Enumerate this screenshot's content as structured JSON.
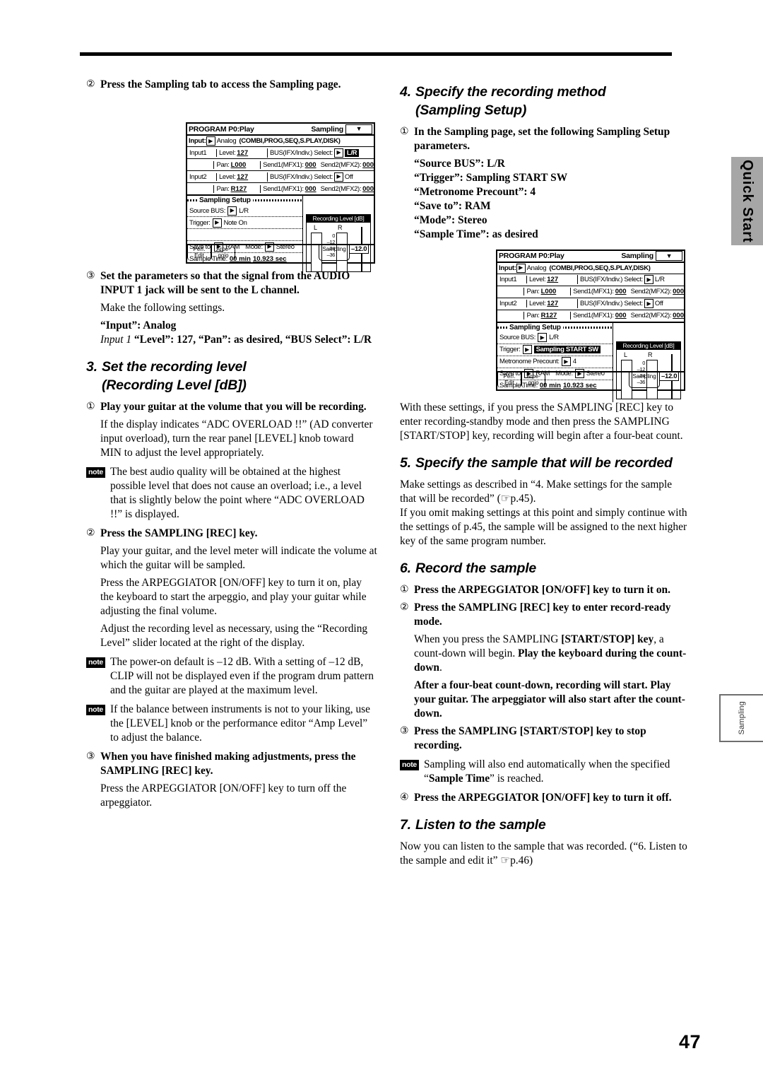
{
  "page": {
    "number": "47",
    "side_tabs": {
      "quick_start": "Quick Start",
      "sampling": "Sampling"
    }
  },
  "left_column": {
    "step2": {
      "circle": "②",
      "text": "Press the Sampling tab to access the Sampling page."
    },
    "step3": {
      "circle": "③",
      "text": "Set the parameters so that the signal from the AUDIO INPUT 1 jack will be sent to the L channel.",
      "body1": "Make the following settings.",
      "body2": "“Input”: Analog",
      "body3_italic": "Input 1",
      "body3_rest": " “Level”: 127, “Pan”: as desired, “BUS Select”: L/R"
    },
    "section3": {
      "number": "3.",
      "title_line1": "Set the recording level",
      "title_line2": "(Recording Level [dB])"
    },
    "s3_step1": {
      "circle": "①",
      "text": "Play your guitar at the volume that you will be recording.",
      "body": "If the display indicates “ADC OVERLOAD !!” (AD converter input overload), turn the rear panel [LEVEL] knob toward MIN to adjust the level appropriately."
    },
    "note1": {
      "badge": "note",
      "text": "The best audio quality will be obtained at the highest possible level that does not cause an overload; i.e., a level that is slightly below the point where “ADC OVERLOAD !!” is displayed."
    },
    "s3_step2": {
      "circle": "②",
      "text": "Press the SAMPLING [REC] key.",
      "body1": "Play your guitar, and the level meter will indicate the volume at which the guitar will be sampled.",
      "body2": "Press the ARPEGGIATOR [ON/OFF] key to turn it on, play the keyboard to start the arpeggio, and play your guitar while adjusting the final volume.",
      "body3": "Adjust the recording level as necessary, using the “Recording Level” slider located at the right of the display."
    },
    "note2": {
      "badge": "note",
      "text": "The power-on default is –12 dB. With a setting of –12 dB, CLIP will not be displayed even if the program drum pattern and the guitar are played at the maximum level."
    },
    "note3": {
      "badge": "note",
      "text": "If the balance between instruments is not to your liking, use the [LEVEL] knob or the performance editor “Amp Level” to adjust the balance."
    },
    "s3_step3": {
      "circle": "③",
      "text": "When you have finished making adjustments, press the SAMPLING [REC] key.",
      "body": "Press the ARPEGGIATOR [ON/OFF] key to turn off the arpeggiator."
    }
  },
  "right_column": {
    "section4": {
      "number": "4.",
      "title_line1": "Specify the recording method",
      "title_line2": "(Sampling Setup)"
    },
    "s4_step1": {
      "circle": "①",
      "text": "In the Sampling page, set the following Sampling Setup parameters.",
      "params": [
        "“Source BUS”: L/R",
        "“Trigger”: Sampling START SW",
        "“Metronome Precount”: 4",
        "“Save to”: RAM",
        "“Mode”: Stereo",
        "“Sample Time”: as desired"
      ]
    },
    "s4_body": "With these settings, if you press the SAMPLING [REC] key to enter recording-standby mode and then press the SAMPLING [START/STOP] key, recording will begin after a four-beat count.",
    "section5": {
      "number": "5.",
      "title": "Specify the sample that will be recorded",
      "body1": "Make settings as described in “4. Make settings for the sample that will be recorded” (☞p.45).",
      "body2": "If you omit making settings at this point and simply continue with the settings of p.45, the sample will be assigned to the next higher key of the same program number."
    },
    "section6": {
      "number": "6.",
      "title": "Record the sample"
    },
    "s6_step1": {
      "circle": "①",
      "text": "Press the ARPEGGIATOR [ON/OFF] key to turn it on."
    },
    "s6_step2": {
      "circle": "②",
      "text": "Press the SAMPLING [REC] key to enter record-ready mode.",
      "body1_a": "When you press the SAMPLING ",
      "body1_b": "[START/STOP] key",
      "body1_c": ", a count-down will begin. ",
      "body1_d": "Play the keyboard during the count-down",
      "body1_e": ".",
      "body2": "After a four-beat count-down, recording will start. Play your guitar. The arpeggiator will also start after the count-down."
    },
    "s6_step3": {
      "circle": "③",
      "text": "Press the SAMPLING [START/STOP] key to stop recording."
    },
    "note4": {
      "badge": "note",
      "text_a": "Sampling will also end automatically when the specified “",
      "text_b": "Sample Time",
      "text_c": "” is reached."
    },
    "s6_step4": {
      "circle": "④",
      "text": "Press the ARPEGGIATOR [ON/OFF] key to turn it off."
    },
    "section7": {
      "number": "7.",
      "title": "Listen to the sample",
      "body": "Now you can listen to the sample that was recorded. (“6. Listen to the sample and edit it” ☞p.46)"
    }
  },
  "lcd1": {
    "title_left": "PROGRAM P0:Play",
    "title_right": "Sampling",
    "dropdown_glyph": "▼",
    "input_label": "Input:",
    "input_value": "Analog",
    "input_modes": "(COMBI,PROG,SEQ,S.PLAY,DISK)",
    "rows": [
      {
        "name": "Input1",
        "param": "Level:",
        "value": "127",
        "bus": "BUS(IFX/Indiv.) Select:",
        "bus_value": "L/R",
        "bus_highlight": true
      },
      {
        "name": "",
        "param": "Pan:",
        "value": "L000",
        "send1": "Send1(MFX1):",
        "send1_value": "000",
        "send2": "Send2(MFX2):",
        "send2_value": "000"
      },
      {
        "name": "Input2",
        "param": "Level:",
        "value": "127",
        "bus": "BUS(IFX/Indiv.) Select:",
        "bus_value": "Off",
        "bus_highlight": false
      },
      {
        "name": "",
        "param": "Pan:",
        "value": "R127",
        "send1": "Send1(MFX1):",
        "send1_value": "000",
        "send2": "Send2(MFX2):",
        "send2_value": "000"
      }
    ],
    "setup_title": "Sampling Setup",
    "setup": {
      "source_bus_label": "Source BUS:",
      "source_bus_value": "L/R",
      "trigger_label": "Trigger:",
      "trigger_value": "Note On",
      "trigger_highlight": false,
      "precount_label": "",
      "precount_value": "",
      "save_to_label": "Save to:",
      "save_to_value": "RAM",
      "mode_label": "Mode:",
      "mode_value": "Stereo",
      "sample_time_label": "Sample Time:",
      "sample_time_min": "00 min",
      "sample_time_sec": "10.923 sec"
    },
    "meter": {
      "title": "Recording Level [dB]",
      "ch_l": "L",
      "ch_r": "R",
      "ticks": [
        "0",
        "–12",
        "–24",
        "–36"
      ],
      "value": "–12.0"
    },
    "tabs": [
      "Perf.\nEdit",
      "Arpe-\nggio",
      "Sampling"
    ],
    "selected_tab": "Sampling"
  },
  "lcd2": {
    "title_left": "PROGRAM P0:Play",
    "title_right": "Sampling",
    "dropdown_glyph": "▼",
    "input_label": "Input:",
    "input_value": "Analog",
    "input_modes": "(COMBI,PROG,SEQ,S.PLAY,DISK)",
    "rows": [
      {
        "name": "Input1",
        "param": "Level:",
        "value": "127",
        "bus": "BUS(IFX/Indiv.) Select:",
        "bus_value": "L/R",
        "bus_highlight": false
      },
      {
        "name": "",
        "param": "Pan:",
        "value": "L000",
        "send1": "Send1(MFX1):",
        "send1_value": "000",
        "send2": "Send2(MFX2):",
        "send2_value": "000"
      },
      {
        "name": "Input2",
        "param": "Level:",
        "value": "127",
        "bus": "BUS(IFX/Indiv.) Select:",
        "bus_value": "Off",
        "bus_highlight": false
      },
      {
        "name": "",
        "param": "Pan:",
        "value": "R127",
        "send1": "Send1(MFX1):",
        "send1_value": "000",
        "send2": "Send2(MFX2):",
        "send2_value": "000"
      }
    ],
    "setup_title": "Sampling Setup",
    "setup": {
      "source_bus_label": "Source BUS:",
      "source_bus_value": "L/R",
      "trigger_label": "Trigger:",
      "trigger_value": "Sampling START SW",
      "trigger_highlight": true,
      "precount_label": "Metronome Precount:",
      "precount_value": "4",
      "save_to_label": "Save to:",
      "save_to_value": "RAM",
      "mode_label": "Mode:",
      "mode_value": "Stereo",
      "sample_time_label": "Sample Time:",
      "sample_time_min": "00 min",
      "sample_time_sec": "10.923 sec"
    },
    "meter": {
      "title": "Recording Level [dB]",
      "ch_l": "L",
      "ch_r": "R",
      "ticks": [
        "0",
        "–12",
        "–24",
        "–36"
      ],
      "value": "–12.0"
    },
    "tabs": [
      "Perf.\nEdit",
      "Arpe-\nggio",
      "Sampling"
    ],
    "selected_tab": "Sampling"
  }
}
